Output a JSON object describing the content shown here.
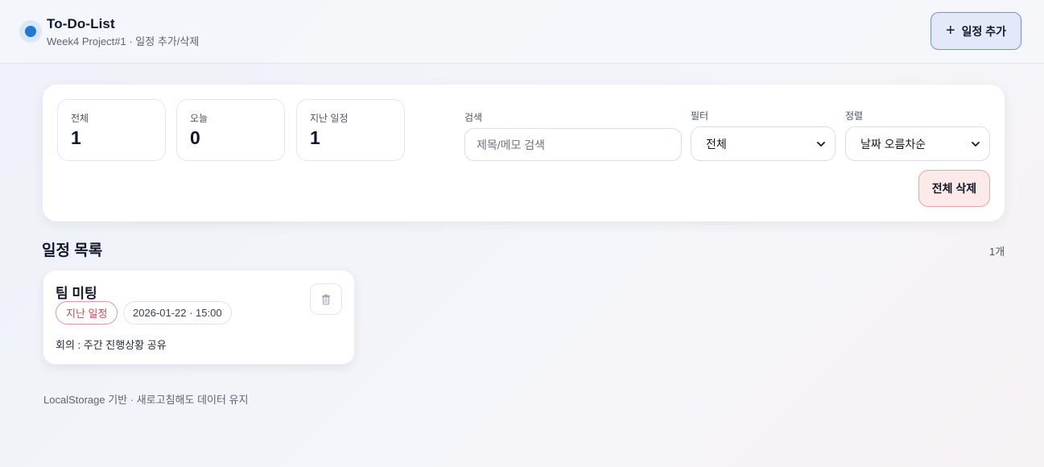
{
  "header": {
    "title": "To-Do-List",
    "subtitle": "Week4 Project#1 · 일정 추가/삭제",
    "add_label": "일정 추가"
  },
  "stats": [
    {
      "label": "전체",
      "value": "1"
    },
    {
      "label": "오늘",
      "value": "0"
    },
    {
      "label": "지난 일정",
      "value": "1"
    }
  ],
  "search": {
    "label": "검색",
    "placeholder": "제목/메모 검색",
    "value": ""
  },
  "filter": {
    "label": "필터",
    "selected": "전체"
  },
  "sort": {
    "label": "정렬",
    "selected": "날짜 오름차순"
  },
  "delete_all_label": "전체 삭제",
  "list": {
    "title": "일정 목록",
    "count": "1개",
    "items": [
      {
        "title": "팀 미팅",
        "status": "지난 일정",
        "datetime": "2026-01-22 · 15:00",
        "memo": "회의 : 주간 진행상황 공유"
      }
    ]
  },
  "footer": "LocalStorage 기반 · 새로고침해도 데이터 유지",
  "colors": {
    "accent": "#1f7ad6",
    "add_button_bg": "#e3e9f8",
    "danger_bg": "#fce9e9",
    "danger_text": "#c0504d"
  }
}
